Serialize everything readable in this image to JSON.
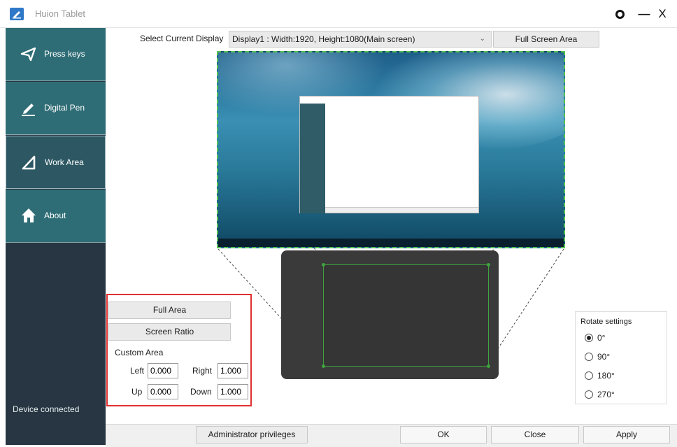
{
  "window": {
    "title": "Huion Tablet",
    "settings_icon": "settings-ring-icon",
    "minimize_label": "—",
    "close_label": "X"
  },
  "sidebar": {
    "items": [
      {
        "label": "Press keys",
        "icon": "press-keys-icon"
      },
      {
        "label": "Digital Pen",
        "icon": "pen-icon"
      },
      {
        "label": "Work Area",
        "icon": "work-area-icon",
        "active": true
      },
      {
        "label": "About",
        "icon": "home-icon"
      }
    ],
    "status": "Device connected",
    "colors": {
      "nav": "#2f6d76",
      "active": "#2d5863",
      "panel": "#273642"
    }
  },
  "display": {
    "label": "Select Current Display",
    "selected": "Display1 : Width:1920, Height:1080(Main screen)",
    "full_screen_button": "Full Screen Area"
  },
  "custom_area": {
    "full_area_button": "Full Area",
    "screen_ratio_button": "Screen Ratio",
    "title": "Custom Area",
    "left_label": "Left",
    "left_value": "0.000",
    "right_label": "Right",
    "right_value": "1.000",
    "up_label": "Up",
    "up_value": "0.000",
    "down_label": "Down",
    "down_value": "1.000",
    "highlight_color": "#e03030"
  },
  "rotate": {
    "title": "Rotate settings",
    "options": [
      "0°",
      "90°",
      "180°",
      "270°"
    ],
    "selected": "0°"
  },
  "footer": {
    "admin_button": "Administrator privileges",
    "ok_button": "OK",
    "close_button": "Close",
    "apply_button": "Apply"
  }
}
